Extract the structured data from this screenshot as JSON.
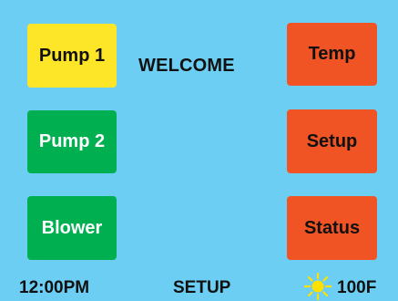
{
  "colors": {
    "background": "#6ccef3",
    "pump1": "#fde627",
    "green_buttons": "#00b050",
    "orange_buttons": "#f05424",
    "sun": "#ffe000"
  },
  "header": {
    "welcome": "WELCOME"
  },
  "left_buttons": [
    {
      "label": "Pump 1"
    },
    {
      "label": "Pump 2"
    },
    {
      "label": "Blower"
    }
  ],
  "right_buttons": [
    {
      "label": "Temp"
    },
    {
      "label": "Setup"
    },
    {
      "label": "Status"
    }
  ],
  "status_bar": {
    "time": "12:00PM",
    "mode": "SETUP",
    "weather_icon": "sun-icon",
    "temperature": "100F"
  }
}
